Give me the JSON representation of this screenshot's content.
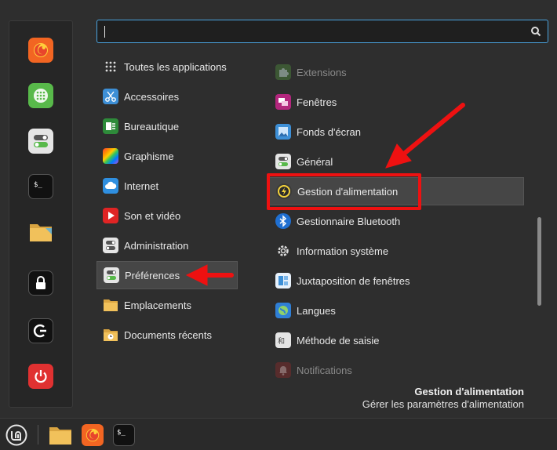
{
  "search": {
    "value": "",
    "placeholder": ""
  },
  "favorites": [
    {
      "name": "firefox-icon",
      "color": "#f26522"
    },
    {
      "name": "calculator-icon",
      "color": "#58b94a"
    },
    {
      "name": "settings-toggle-icon",
      "color": "#e5e5e5"
    },
    {
      "name": "terminal-icon",
      "color": "#111111"
    },
    {
      "name": "folder-icon",
      "color": "#f1c15b"
    },
    {
      "name": "lock-icon",
      "color": "#111111"
    },
    {
      "name": "logout-icon",
      "color": "#111111"
    },
    {
      "name": "power-icon",
      "color": "#e03131"
    }
  ],
  "categories": [
    {
      "label": "Toutes les applications",
      "icon": "grid-icon"
    },
    {
      "label": "Accessoires",
      "icon": "scissors-icon"
    },
    {
      "label": "Bureautique",
      "icon": "office-icon"
    },
    {
      "label": "Graphisme",
      "icon": "graphics-icon"
    },
    {
      "label": "Internet",
      "icon": "cloud-icon"
    },
    {
      "label": "Son et vidéo",
      "icon": "play-icon"
    },
    {
      "label": "Administration",
      "icon": "admin-toggle-icon"
    },
    {
      "label": "Préférences",
      "icon": "preferences-toggle-icon"
    },
    {
      "label": "Emplacements",
      "icon": "places-folder-icon"
    },
    {
      "label": "Documents récents",
      "icon": "recent-folder-icon"
    }
  ],
  "apps": [
    {
      "label": "Extensions",
      "icon": "puzzle-icon"
    },
    {
      "label": "Fenêtres",
      "icon": "windows-icon"
    },
    {
      "label": "Fonds d'écran",
      "icon": "wallpaper-icon"
    },
    {
      "label": "Général",
      "icon": "general-toggle-icon"
    },
    {
      "label": "Gestion d'alimentation",
      "icon": "power-management-icon"
    },
    {
      "label": "Gestionnaire Bluetooth",
      "icon": "bluetooth-icon"
    },
    {
      "label": "Information système",
      "icon": "system-info-gear-icon"
    },
    {
      "label": "Juxtaposition de fenêtres",
      "icon": "tiling-icon"
    },
    {
      "label": "Langues",
      "icon": "languages-globe-icon"
    },
    {
      "label": "Méthode de saisie",
      "icon": "input-method-icon"
    },
    {
      "label": "Notifications",
      "icon": "notifications-bell-icon"
    }
  ],
  "description": {
    "title": "Gestion d'alimentation",
    "text": "Gérer les paramètres d'alimentation"
  },
  "panel": [
    {
      "name": "mint-menu-icon"
    },
    {
      "name": "files-folder-icon"
    },
    {
      "name": "firefox-icon"
    },
    {
      "name": "terminal-icon"
    }
  ],
  "colors": {
    "accent": "#4aa3df",
    "highlight_red": "#ee1111",
    "selected_bg": "#464646"
  }
}
